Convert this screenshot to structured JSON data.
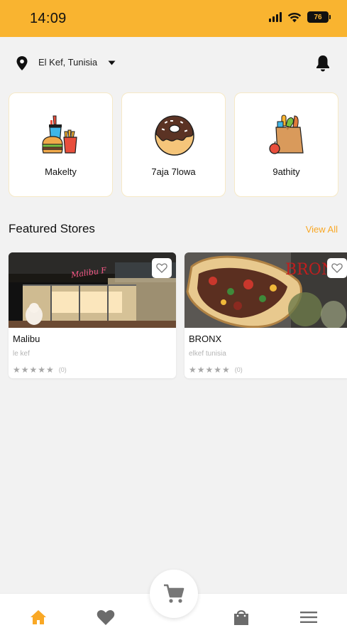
{
  "status_bar": {
    "time": "14:09",
    "battery": "76"
  },
  "header": {
    "location": "El Kef, Tunisia"
  },
  "categories": [
    {
      "label": "Makelty",
      "icon": "fast-food-icon"
    },
    {
      "label": "7aja 7lowa",
      "icon": "donut-icon"
    },
    {
      "label": "9athity",
      "icon": "grocery-bag-icon"
    }
  ],
  "featured": {
    "title": "Featured Stores",
    "view_all": "View All",
    "stores": [
      {
        "name": "Malibu",
        "location": "le kef",
        "stars": "★★★★★",
        "reviews": "(0)",
        "sign_text": "Malibu F"
      },
      {
        "name": "BRONX",
        "location": "elkef tunisia",
        "stars": "★★★★★",
        "reviews": "(0)",
        "sign_text": "BRONX"
      }
    ]
  },
  "bottom_nav": [
    "home-icon",
    "heart-icon",
    "cart-icon",
    "bag-icon",
    "menu-icon"
  ],
  "colors": {
    "accent": "#f9b430",
    "link": "#f9a825",
    "nav_active": "#f9a825",
    "nav_inactive": "#6b6b6b"
  }
}
